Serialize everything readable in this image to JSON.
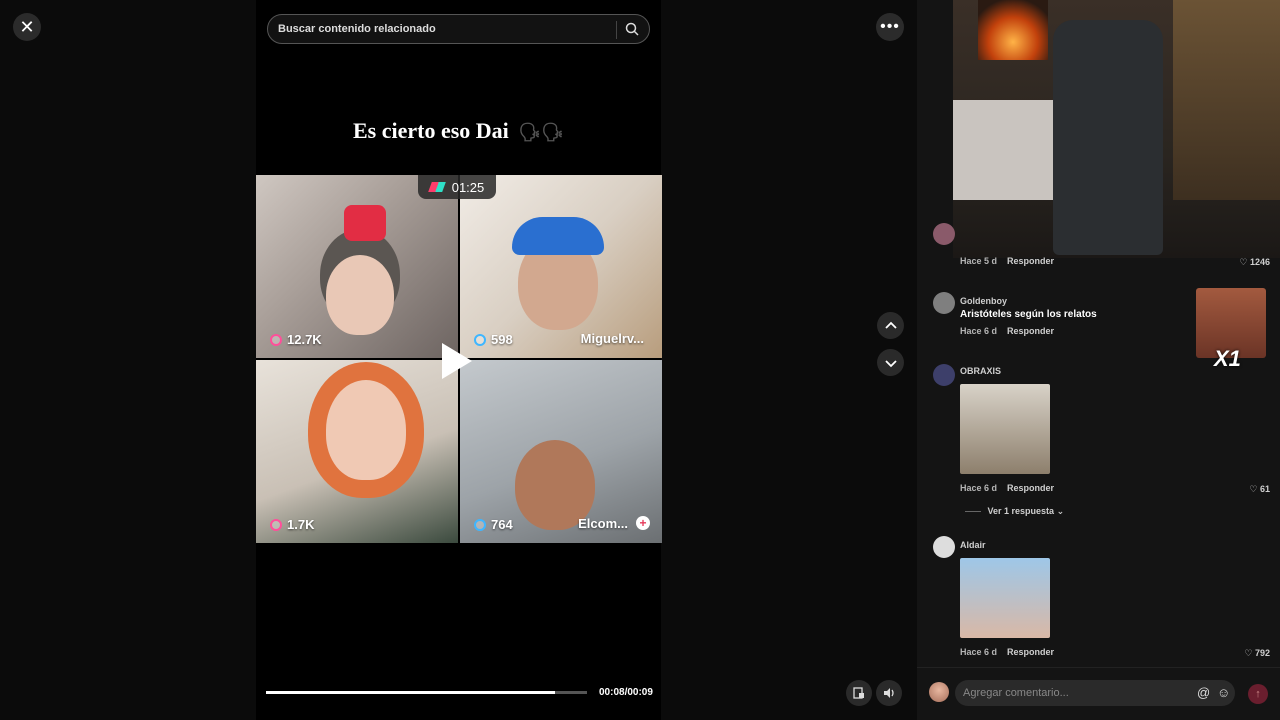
{
  "search": {
    "placeholder": "Buscar contenido relacionado"
  },
  "video": {
    "caption": "Es cierto eso Dai",
    "caption_emoji": "🗣🗣",
    "timer": "01:25",
    "progress": 0.9,
    "time": "00:08/00:09",
    "tiles": [
      {
        "count": "12.7K",
        "name": ""
      },
      {
        "count": "598",
        "name": "Miguelrv..."
      },
      {
        "count": "1.7K",
        "name": ""
      },
      {
        "count": "764",
        "name": "Elcom..."
      }
    ]
  },
  "comments": [
    {
      "user": "",
      "text": "",
      "time": "Hace 5 d",
      "reply": "Responder",
      "likes": "1246"
    },
    {
      "user": "Goldenboy",
      "text": "Aristóteles según los relatos",
      "time": "Hace 6 d",
      "reply": "Responder",
      "likes": ""
    },
    {
      "user": "OBRAXIS",
      "text": "",
      "time": "Hace 6 d",
      "reply": "Responder",
      "likes": "61",
      "view_replies": "Ver 1 respuesta"
    },
    {
      "user": "Aldair",
      "text": "",
      "time": "Hace 6 d",
      "reply": "Responder",
      "likes": "792"
    }
  ],
  "meme_text": "X1",
  "comment_input": {
    "placeholder": "Agregar comentario..."
  },
  "colors": {
    "accent_pink": "#ff3b6b",
    "accent_teal": "#2fe0c8",
    "send_bg": "#6a1e2e"
  }
}
